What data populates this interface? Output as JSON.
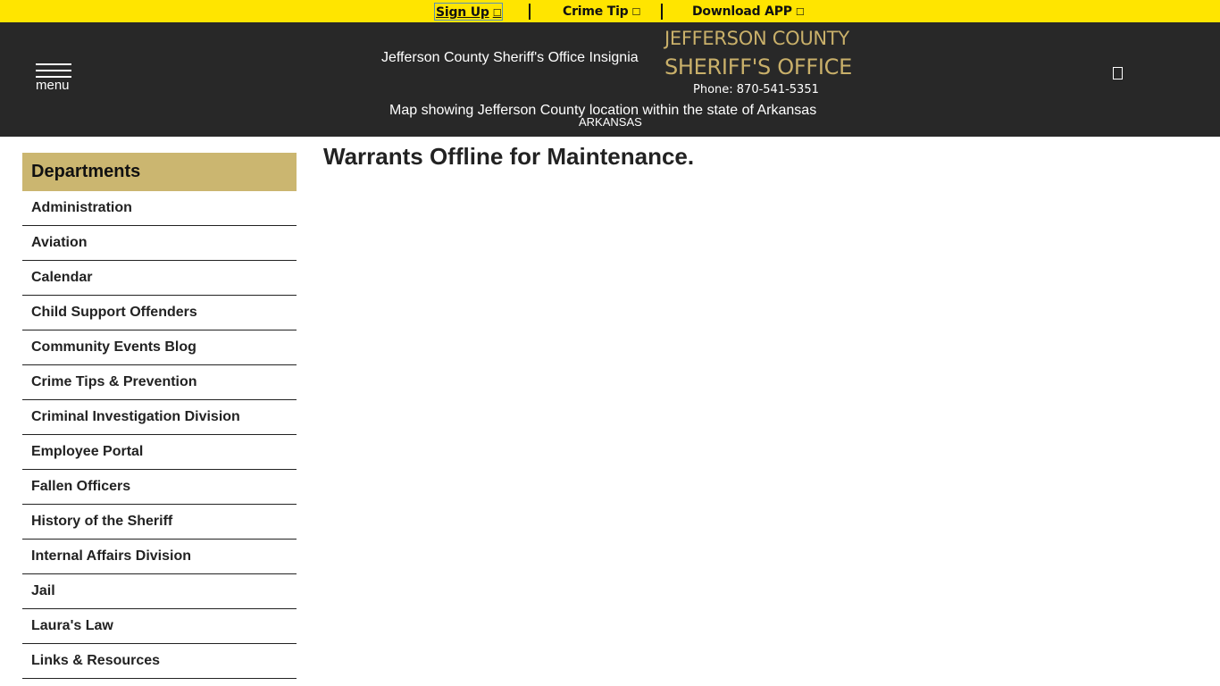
{
  "topbar": {
    "links": [
      {
        "label": "Sign Up",
        "icon": "external-link-icon"
      },
      {
        "label": "Crime Tip",
        "icon": "external-link-icon"
      },
      {
        "label": "Download APP",
        "icon": "external-link-icon"
      }
    ],
    "icon_glyph": "☐",
    "background": "#ffe500"
  },
  "header": {
    "menu_label": "menu",
    "insignia_alt": "Jefferson County Sheriff's Office Insignia",
    "org_line1": "JEFFERSON COUNTY",
    "org_line2": "SHERIFF'S OFFICE",
    "phone": "Phone: 870-541-5351",
    "map_alt": "Map showing Jefferson County location within the state of Arkansas",
    "state_label": "ARKANSAS",
    "search_icon": "search-icon",
    "background": "#282828",
    "accent": "#c9b06a"
  },
  "sidebar": {
    "heading": "Departments",
    "heading_color": "#cbb670",
    "items": [
      {
        "label": "Administration"
      },
      {
        "label": "Aviation"
      },
      {
        "label": "Calendar"
      },
      {
        "label": "Child Support Offenders"
      },
      {
        "label": "Community Events Blog"
      },
      {
        "label": "Crime Tips & Prevention"
      },
      {
        "label": "Criminal Investigation Division"
      },
      {
        "label": "Employee Portal"
      },
      {
        "label": "Fallen Officers"
      },
      {
        "label": "History of the Sheriff"
      },
      {
        "label": "Internal Affairs Division"
      },
      {
        "label": "Jail"
      },
      {
        "label": "Laura's Law"
      },
      {
        "label": "Links & Resources"
      }
    ]
  },
  "main": {
    "title": "Warrants Offline for Maintenance."
  }
}
